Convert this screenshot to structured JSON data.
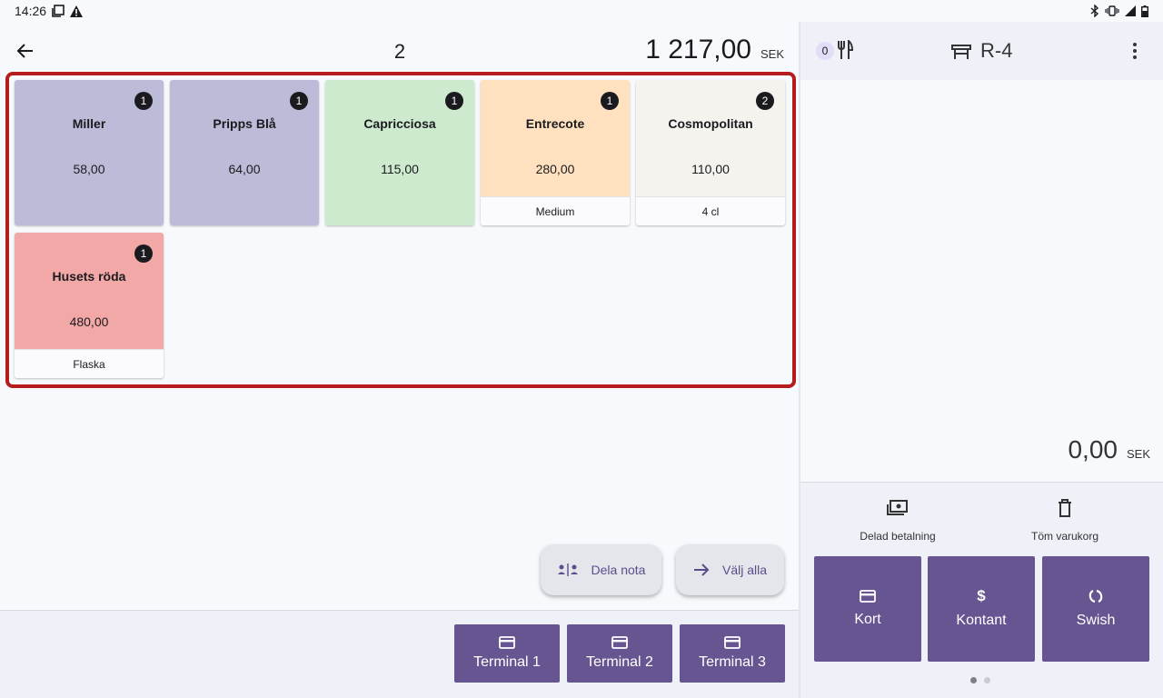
{
  "status_bar": {
    "time": "14:26"
  },
  "order": {
    "number": "2",
    "total_amount": "1 217,00",
    "currency": "SEK"
  },
  "items": [
    {
      "name": "Miller",
      "price": "58,00",
      "qty": "1",
      "variant": "",
      "color": "#bcbcd9"
    },
    {
      "name": "Pripps Blå",
      "price": "64,00",
      "qty": "1",
      "variant": "",
      "color": "#bcbcd9"
    },
    {
      "name": "Capricciosa",
      "price": "115,00",
      "qty": "1",
      "variant": "",
      "color": "#cdeacf"
    },
    {
      "name": "Entrecote",
      "price": "280,00",
      "qty": "1",
      "variant": "Medium",
      "color": "#ffe1c0"
    },
    {
      "name": "Cosmopolitan",
      "price": "110,00",
      "qty": "2",
      "variant": "4 cl",
      "color": "#f4f3ee"
    },
    {
      "name": "Husets röda",
      "price": "480,00",
      "qty": "1",
      "variant": "Flaska",
      "color": "#f3a8a8"
    }
  ],
  "actions": {
    "split_bill": "Dela nota",
    "select_all": "Välj alla"
  },
  "terminals": [
    {
      "label": "Terminal 1"
    },
    {
      "label": "Terminal 2"
    },
    {
      "label": "Terminal 3"
    }
  ],
  "cart": {
    "badge_count": "0",
    "table_label": "R-4",
    "total_amount": "0,00",
    "currency": "SEK",
    "split_payment": "Delad betalning",
    "empty_cart": "Töm varukorg"
  },
  "payments": [
    {
      "label": "Kort",
      "icon": "card-icon"
    },
    {
      "label": "Kontant",
      "icon": "dollar-icon",
      "symbol": "$"
    },
    {
      "label": "Swish",
      "icon": "swish-icon"
    }
  ],
  "colors": {
    "accent": "#665591",
    "highlight_border": "#b71c1c"
  }
}
